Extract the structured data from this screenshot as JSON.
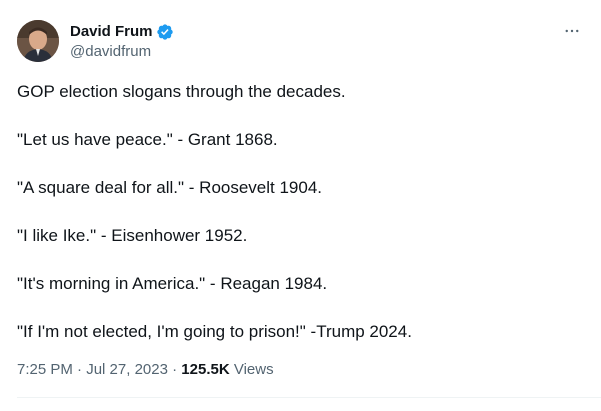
{
  "author": {
    "name": "David Frum",
    "handle": "@davidfrum",
    "verified": true
  },
  "tweet": {
    "lines": [
      "GOP election slogans through the decades.",
      "\"Let us have peace.\" - Grant 1868.",
      "\"A square deal for all.\" - Roosevelt 1904.",
      "\"I like Ike.\" - Eisenhower 1952.",
      "\"It's morning in America.\" - Reagan 1984.",
      "\"If I'm not elected, I'm going to prison!\" -Trump 2024."
    ]
  },
  "meta": {
    "time": "7:25 PM",
    "separator": "·",
    "date": "Jul 27, 2023",
    "views_count": "125.5K",
    "views_label": "Views"
  },
  "icons": {
    "more": "more-horizontal-icon",
    "verified": "verified-badge-icon",
    "avatar": "avatar"
  },
  "colors": {
    "verified_blue": "#1d9bf0",
    "secondary_text": "#536471",
    "primary_text": "#0f1419"
  }
}
